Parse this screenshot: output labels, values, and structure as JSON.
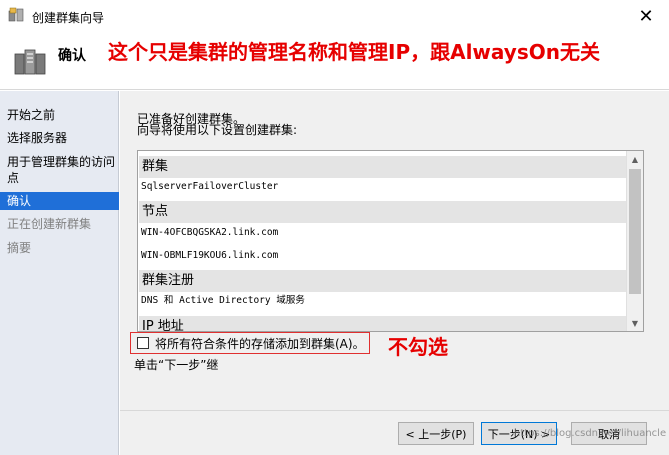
{
  "window": {
    "title": "创建群集向导",
    "close_glyph": "✕"
  },
  "header": {
    "title": "确认",
    "annotation": "这个只是集群的管理名称和管理IP，跟AlwaysOn无关"
  },
  "nav": {
    "items": [
      {
        "label": "开始之前",
        "state": "normal"
      },
      {
        "label": "选择服务器",
        "state": "normal"
      },
      {
        "label": "用于管理群集的访问",
        "label2": "点",
        "state": "normal"
      },
      {
        "label": "确认",
        "state": "active"
      },
      {
        "label": "正在创建新群集",
        "state": "disabled"
      },
      {
        "label": "摘要",
        "state": "disabled"
      }
    ]
  },
  "main": {
    "line1": "已准备好创建群集。",
    "line2": "向导将使用以下设置创建群集:",
    "sections": [
      {
        "heading": "群集",
        "items": [
          "SqlserverFailoverCluster"
        ]
      },
      {
        "heading": "节点",
        "items": [
          "WIN-4OFCBQGSKA2.link.com",
          "WIN-OBMLF19KOU6.link.com"
        ]
      },
      {
        "heading": "群集注册",
        "items": [
          "DNS 和 Active Directory 域服务"
        ]
      },
      {
        "heading": "IP 地址",
        "items": []
      }
    ],
    "checkbox_label": "将所有符合条件的存储添加到群集(A)。",
    "checkbox_checked": false,
    "annotation2": "不勾选",
    "hint": "单击“下一步”继"
  },
  "buttons": {
    "back": "< 上一步(P)",
    "next": "下一步(N) >",
    "cancel": "取消"
  },
  "watermark": "https://blog.csdn.net/lihuancle",
  "colors": {
    "accent": "#1f6fd8",
    "annotation": "#e60000",
    "nav_bg": "#e6eaf2"
  }
}
